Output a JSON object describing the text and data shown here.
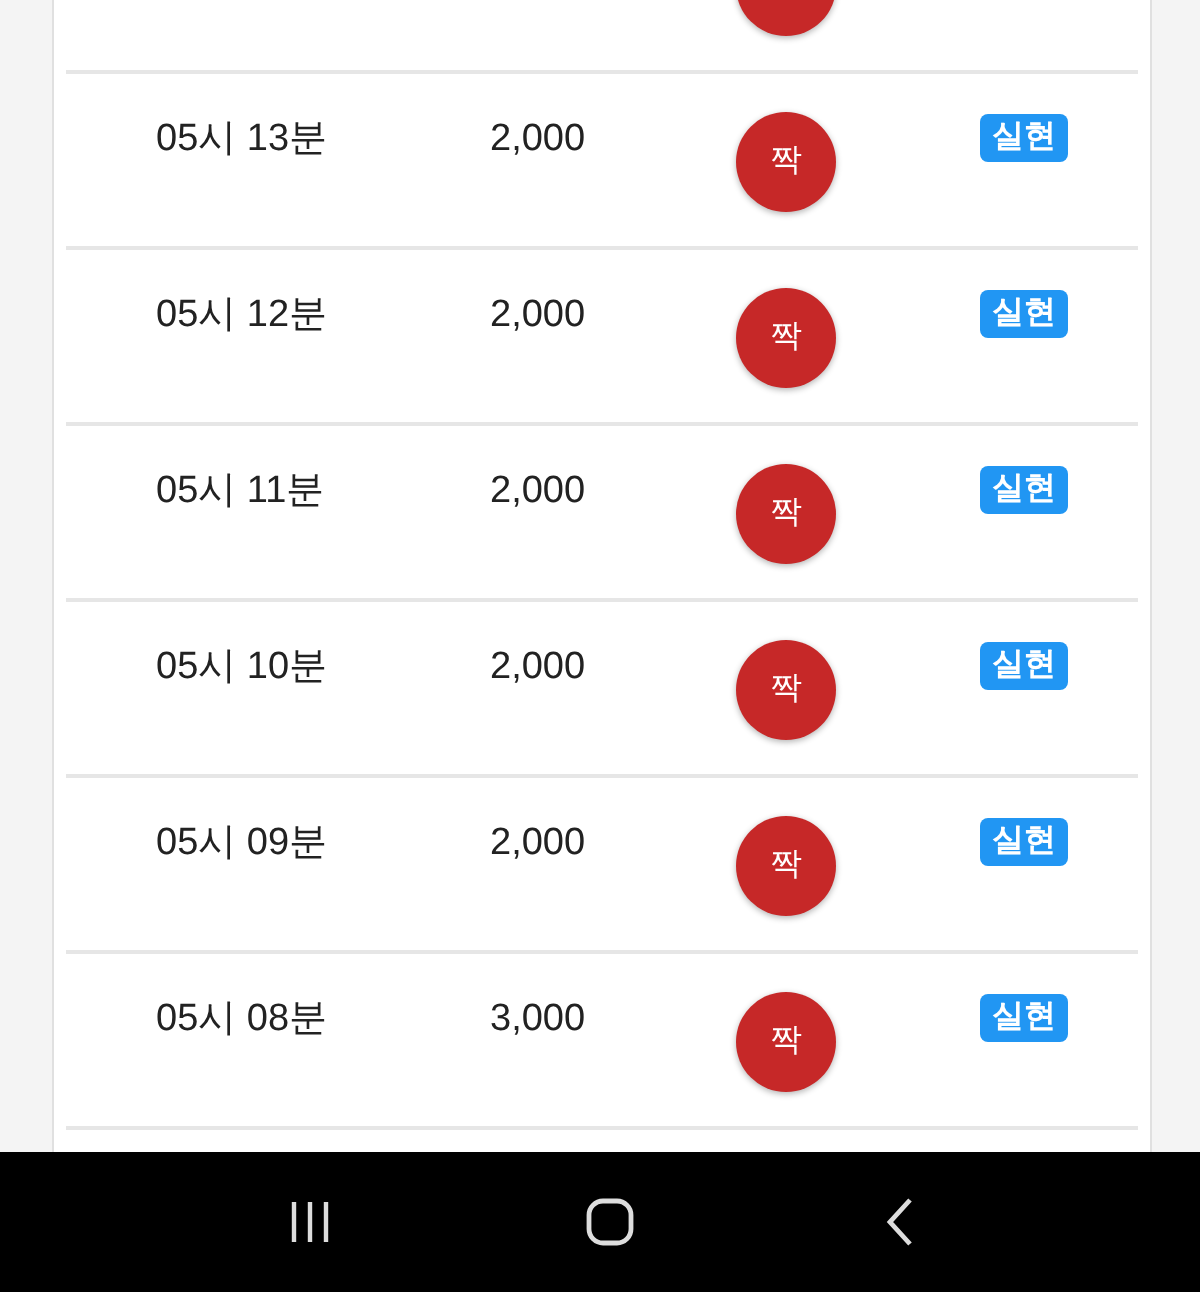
{
  "rows": [
    {
      "kind": "partial",
      "result": {
        "kind": "even"
      }
    },
    {
      "kind": "full",
      "time": "05시 13분",
      "amount": "2,000",
      "result": {
        "kind": "even",
        "label": "짝"
      },
      "status": "실현"
    },
    {
      "kind": "full",
      "time": "05시 12분",
      "amount": "2,000",
      "result": {
        "kind": "even",
        "label": "짝"
      },
      "status": "실현"
    },
    {
      "kind": "full",
      "time": "05시 11분",
      "amount": "2,000",
      "result": {
        "kind": "even",
        "label": "짝"
      },
      "status": "실현"
    },
    {
      "kind": "full",
      "time": "05시 10분",
      "amount": "2,000",
      "result": {
        "kind": "even",
        "label": "짝"
      },
      "status": "실현"
    },
    {
      "kind": "full",
      "time": "05시 09분",
      "amount": "2,000",
      "result": {
        "kind": "even",
        "label": "짝"
      },
      "status": "실현"
    },
    {
      "kind": "full",
      "time": "05시 08분",
      "amount": "3,000",
      "result": {
        "kind": "even",
        "label": "짝"
      },
      "status": "실현"
    }
  ],
  "nav_bar": {
    "buttons": [
      {
        "kind": "recents"
      },
      {
        "kind": "home"
      },
      {
        "kind": "back"
      }
    ]
  }
}
